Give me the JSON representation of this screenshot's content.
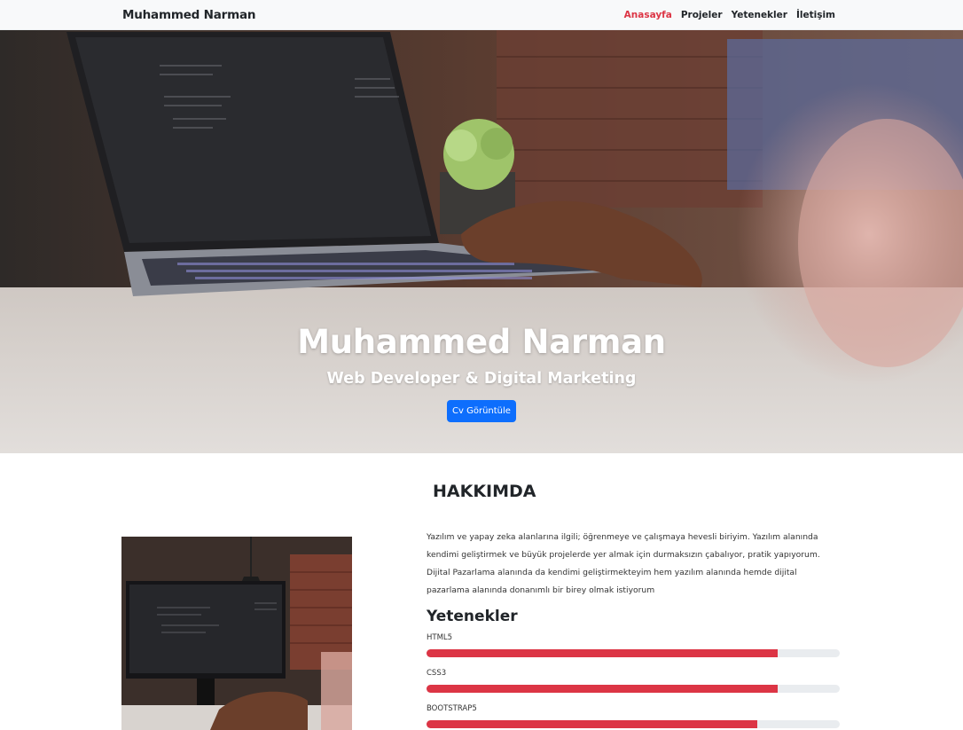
{
  "navbar": {
    "brand": "Muhammed Narman",
    "links": [
      {
        "label": "Anasayfa",
        "active": true
      },
      {
        "label": "Projeler",
        "active": false
      },
      {
        "label": "Yetenekler",
        "active": false
      },
      {
        "label": "İletişim",
        "active": false
      }
    ],
    "active_color": "#dc3545"
  },
  "hero": {
    "title": "Muhammed Narman",
    "subtitle": "Web Developer & Digital Marketing",
    "cv_button": "Cv Görüntüle",
    "button_color": "#0d6efd"
  },
  "about": {
    "title": "HAKKIMDA",
    "text": "Yazılım ve yapay zeka alanlarına ilgili; öğrenmeye ve çalışmaya hevesli biriyim. Yazılım alanında kendimi geliştirmek ve büyük projelerde yer almak için durmaksızın çabalıyor, pratik yapıyorum. Dijital Pazarlama alanında da kendimi geliştirmekteyim hem yazılım alanında hemde dijital pazarlama alanında donanımlı bir birey olmak istiyorum",
    "skills_title": "Yetenekler",
    "skills": [
      {
        "name": "HTML5",
        "level": 0.85
      },
      {
        "name": "CSS3",
        "level": 0.85
      },
      {
        "name": "BOOTSTRAP5",
        "level": 0.8
      }
    ],
    "bar_color": "#dc3545"
  }
}
